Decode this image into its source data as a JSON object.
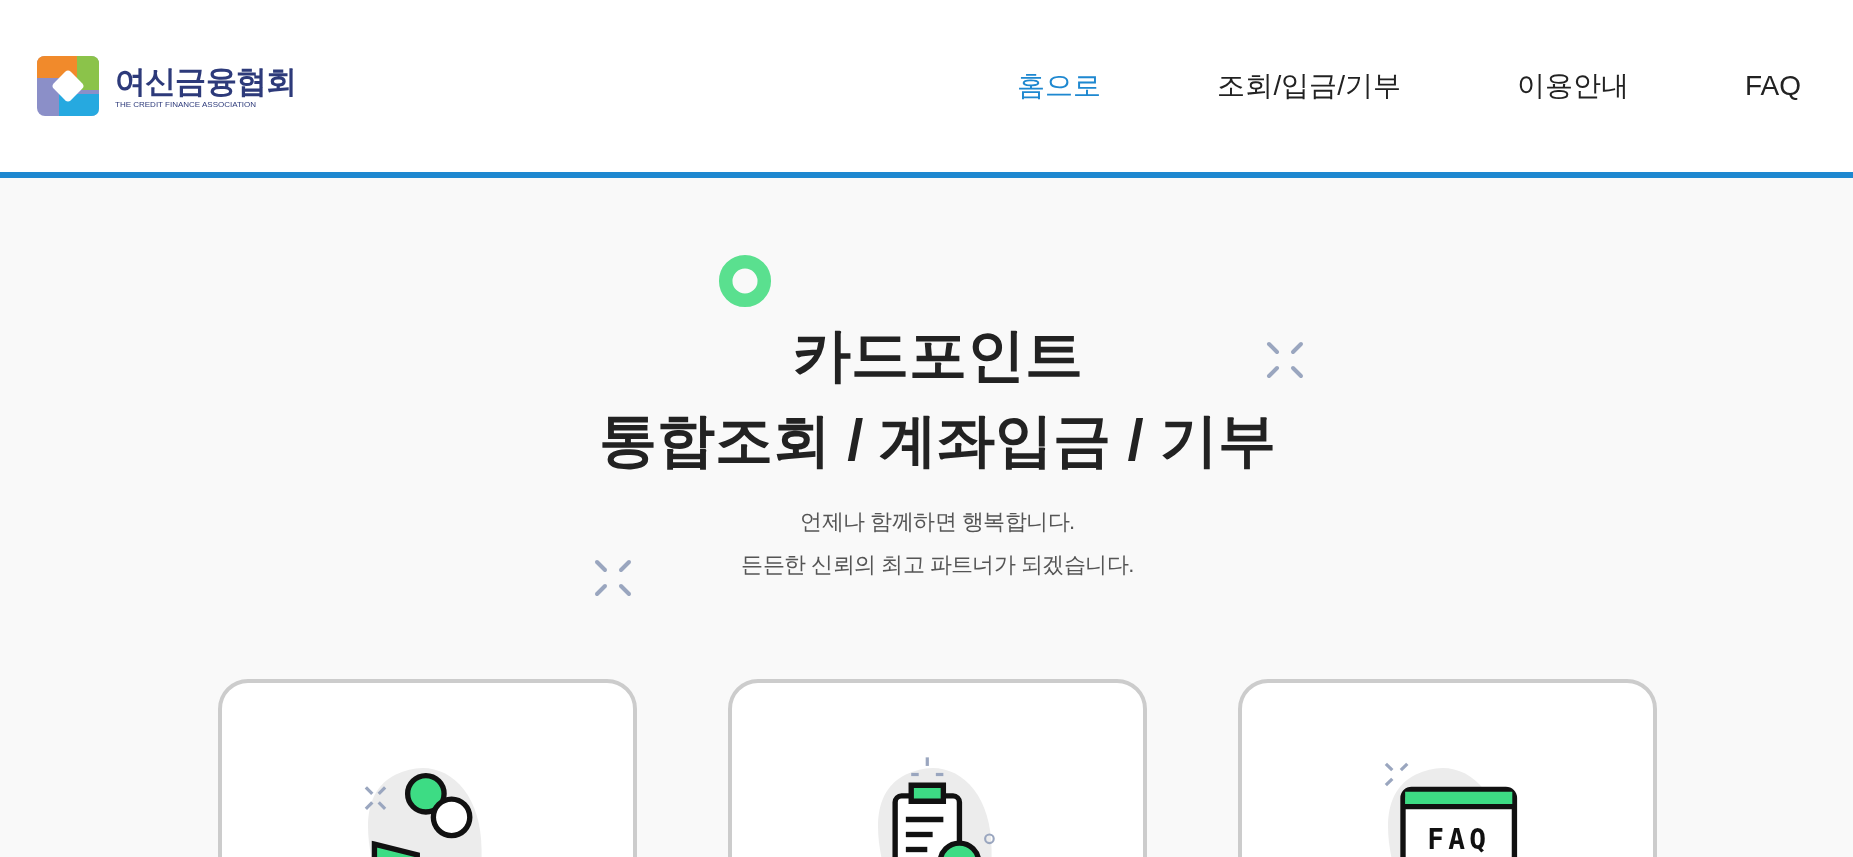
{
  "header": {
    "logo": {
      "name": "여신금융협회",
      "subtitle": "THE CREDIT FINANCE ASSOCIATION"
    },
    "nav": [
      {
        "label": "홈으로",
        "selected": true
      },
      {
        "label": "조회/입금/기부",
        "selected": false
      },
      {
        "label": "이용안내",
        "selected": false
      },
      {
        "label": "FAQ",
        "selected": false
      }
    ]
  },
  "hero": {
    "title_lines": [
      "카드포인트",
      "통합조회 / 계좌입금 / 기부"
    ],
    "subtitle_lines": [
      "언제나 함께하면 행복합니다.",
      "든든한 신뢰의 최고 파트너가 되겠습니다."
    ]
  },
  "cards": [
    {
      "kind": "search"
    },
    {
      "kind": "clipboard"
    },
    {
      "kind": "faq",
      "icon_text": "FAQ"
    }
  ]
}
